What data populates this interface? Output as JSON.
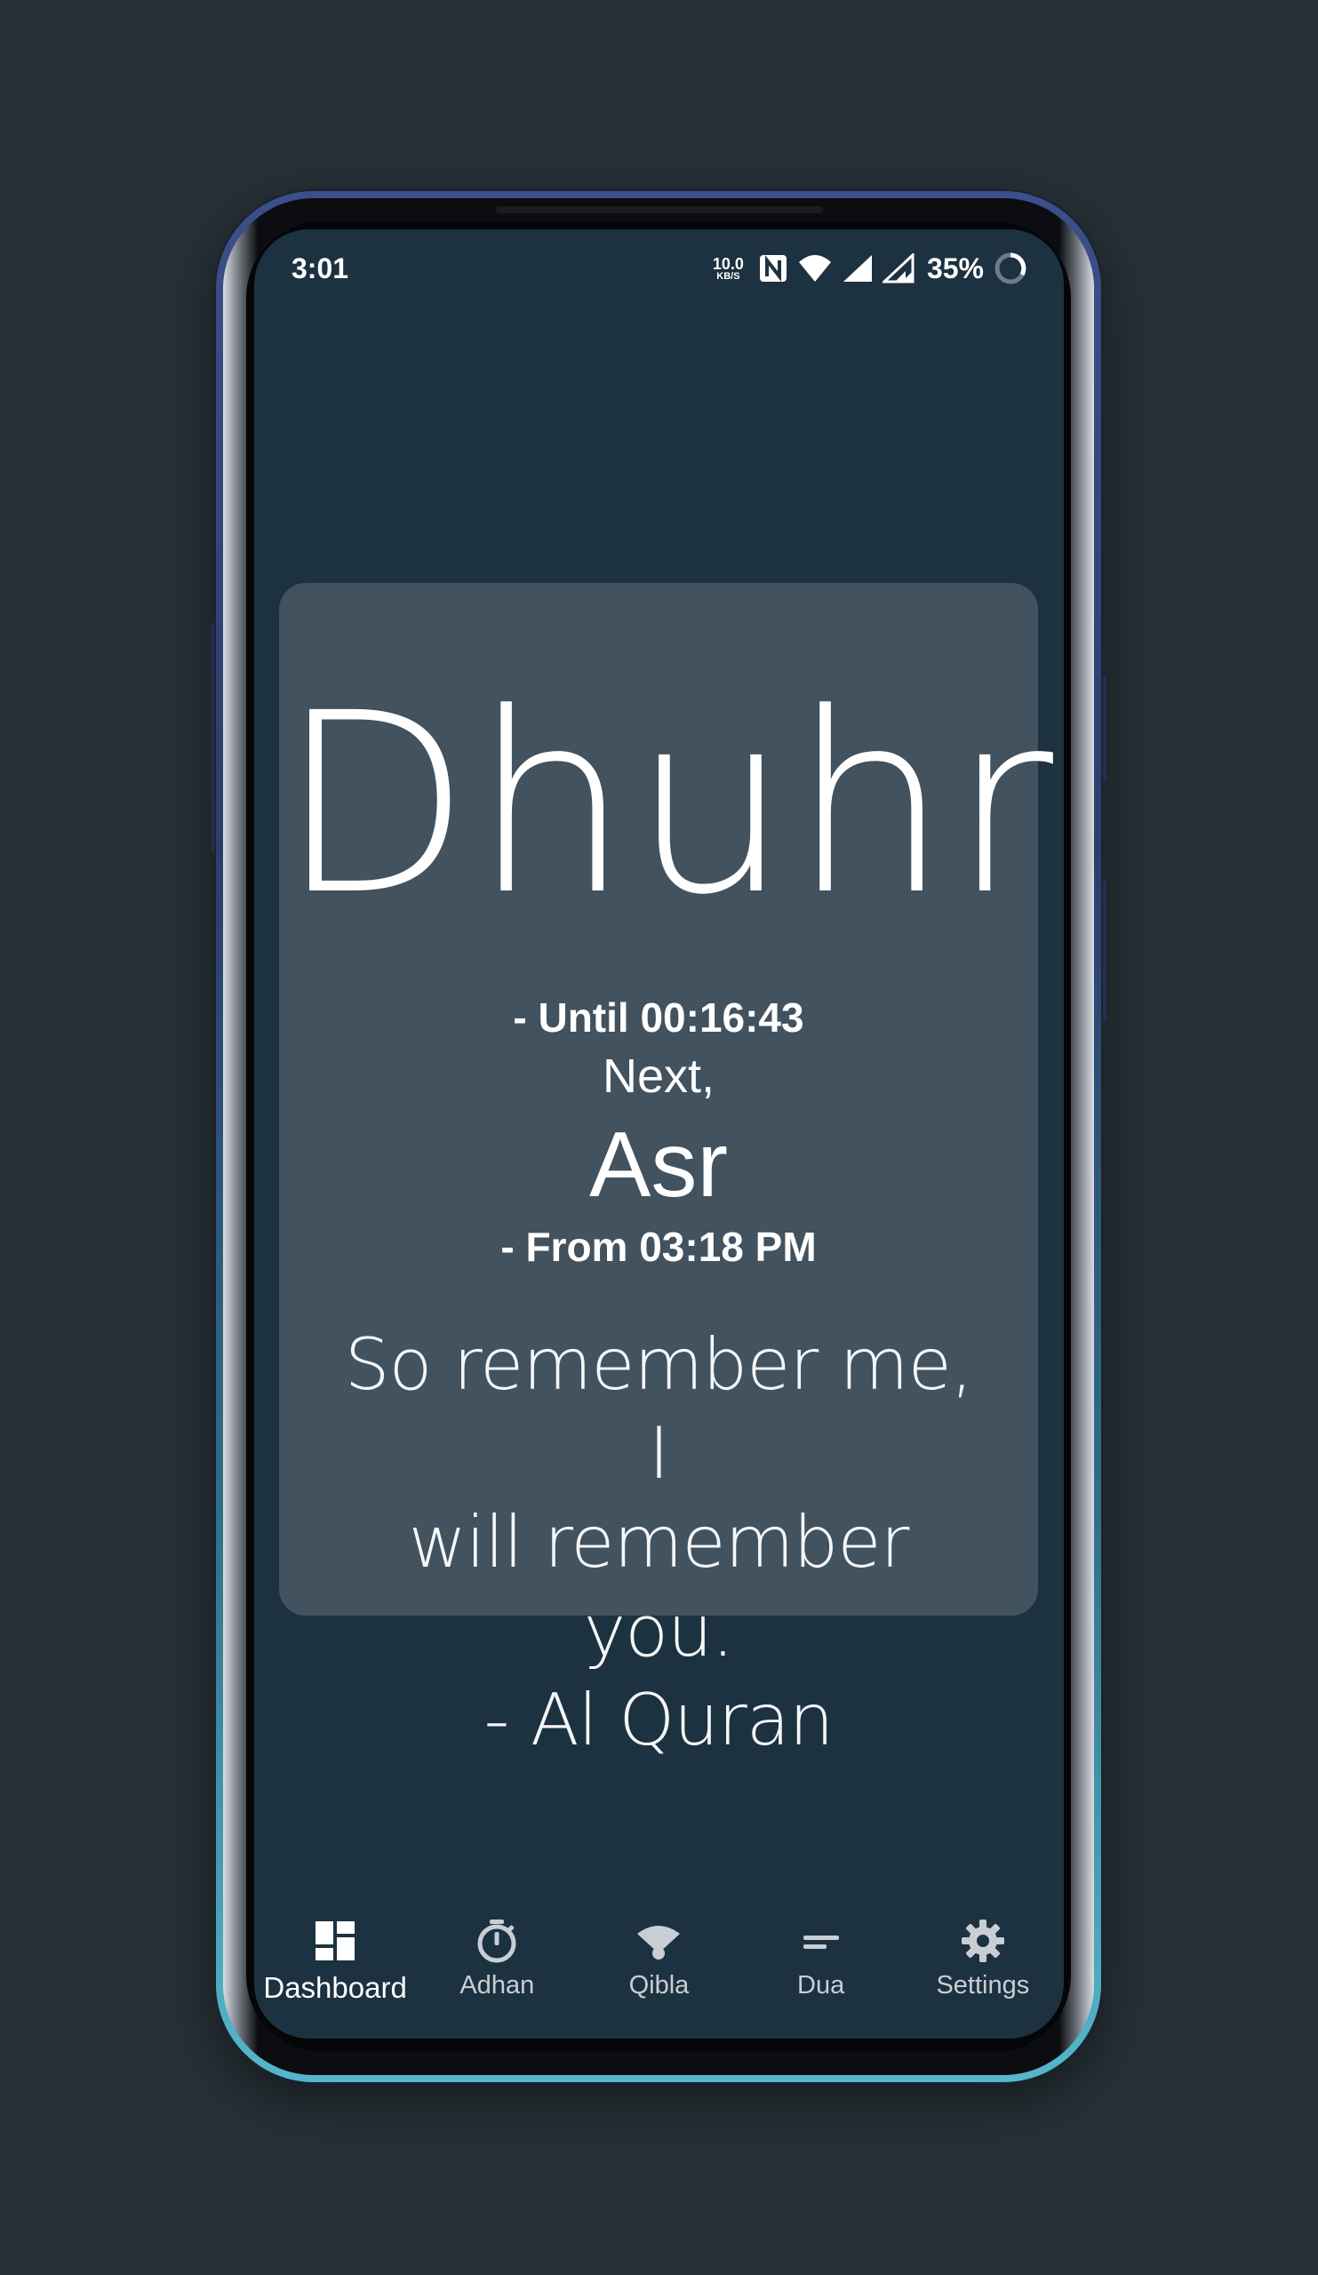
{
  "status_bar": {
    "time": "3:01",
    "net_speed_value": "10.0",
    "net_speed_unit": "KB/S",
    "battery_percent": "35%"
  },
  "dashboard": {
    "current_prayer": "Dhuhr",
    "until_text": "- Until 00:16:43",
    "next_label": "Next,",
    "next_prayer": "Asr",
    "from_text": "- From 03:18 PM",
    "quote_lines": [
      "So remember me, I",
      "will remember you.",
      "- Al Quran"
    ]
  },
  "bottom_nav": {
    "items": [
      {
        "label": "Dashboard",
        "icon": "dashboard-icon",
        "active": true
      },
      {
        "label": "Adhan",
        "icon": "timer-icon",
        "active": false
      },
      {
        "label": "Qibla",
        "icon": "qibla-icon",
        "active": false
      },
      {
        "label": "Dua",
        "icon": "dua-icon",
        "active": false
      },
      {
        "label": "Settings",
        "icon": "gear-icon",
        "active": false
      }
    ]
  },
  "colors": {
    "background": "#263036",
    "screen": "#1d3240",
    "card": "#42525e",
    "text": "#ffffff",
    "nav_inactive": "#c8ced3"
  }
}
